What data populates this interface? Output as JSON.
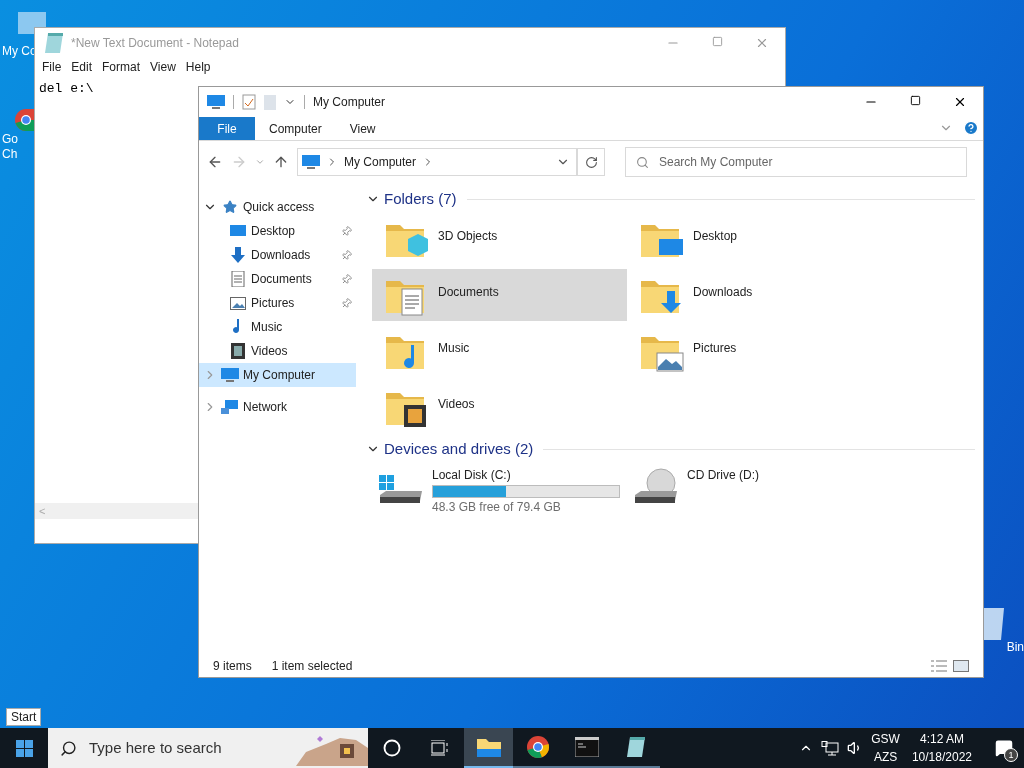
{
  "desktop_icons": [
    {
      "kind": "computer",
      "lines": [
        "My Co"
      ]
    },
    {
      "kind": "chrome",
      "lines": [
        "Go",
        "Ch"
      ]
    },
    {
      "kind": "bin",
      "lines": [
        "Bin"
      ]
    }
  ],
  "notepad": {
    "title": "*New Text Document - Notepad",
    "menu": [
      "File",
      "Edit",
      "Format",
      "View",
      "Help"
    ],
    "text": "del e:\\",
    "scroll_left": "<"
  },
  "explorer": {
    "title": "My Computer",
    "ribbon_tabs": [
      {
        "label": "File",
        "selected": true
      },
      {
        "label": "Computer",
        "selected": false
      },
      {
        "label": "View",
        "selected": false
      }
    ],
    "address": {
      "crumb": "My Computer"
    },
    "search": {
      "placeholder": "Search My Computer"
    },
    "nav": [
      {
        "label": "Quick access",
        "kind": "star",
        "expanded": true,
        "selected": false,
        "children": [
          {
            "label": "Desktop",
            "kind": "desktop",
            "pinned": true
          },
          {
            "label": "Downloads",
            "kind": "downloads",
            "pinned": true
          },
          {
            "label": "Documents",
            "kind": "documents",
            "pinned": true
          },
          {
            "label": "Pictures",
            "kind": "pictures",
            "pinned": true
          },
          {
            "label": "Music",
            "kind": "music",
            "pinned": false
          },
          {
            "label": "Videos",
            "kind": "videos",
            "pinned": false
          }
        ]
      },
      {
        "label": "My Computer",
        "kind": "computer",
        "expanded": false,
        "selected": true
      },
      {
        "label": "Network",
        "kind": "network",
        "expanded": false,
        "selected": false
      }
    ],
    "folders": {
      "title": "Folders (7)",
      "expanded": true,
      "items": [
        {
          "name": "3D Objects",
          "kind": "objects",
          "selected": false
        },
        {
          "name": "Desktop",
          "kind": "desktop",
          "selected": false
        },
        {
          "name": "Documents",
          "kind": "documents",
          "selected": true
        },
        {
          "name": "Downloads",
          "kind": "downloads",
          "selected": false
        },
        {
          "name": "Music",
          "kind": "music",
          "selected": false
        },
        {
          "name": "Pictures",
          "kind": "pictures",
          "selected": false
        },
        {
          "name": "Videos",
          "kind": "videos",
          "selected": false
        }
      ]
    },
    "drives": {
      "title": "Devices and drives (2)",
      "expanded": true,
      "items": [
        {
          "kind": "disk",
          "name": "Local Disk (C:)",
          "level": 0.39,
          "free": "48.3 GB free of 79.4 GB"
        },
        {
          "kind": "cd",
          "name": "CD Drive (D:)"
        }
      ]
    },
    "status": [
      "9 items",
      "1 item selected"
    ]
  },
  "taskbar": {
    "tooltip": "Start",
    "search_placeholder": "Type here to search",
    "apps": [
      {
        "kind": "explorer",
        "active": true
      },
      {
        "kind": "chrome",
        "active": false
      },
      {
        "kind": "cmd",
        "active": false
      },
      {
        "kind": "notepad",
        "active": false
      }
    ],
    "language": [
      "GSW",
      "AZS"
    ],
    "time": "4:12 AM",
    "date": "10/18/2022",
    "notifications": "1"
  }
}
